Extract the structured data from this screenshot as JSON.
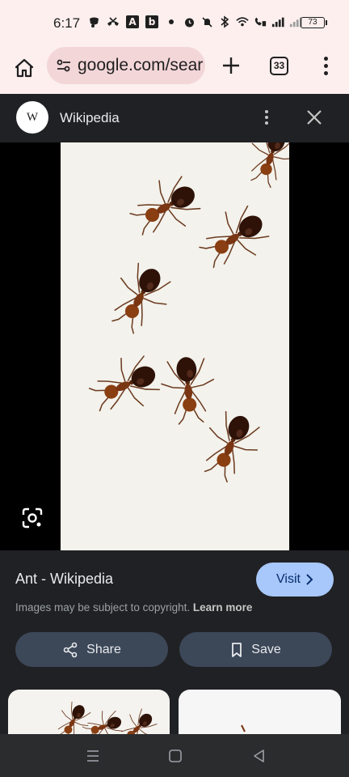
{
  "status_bar": {
    "time": "6:17",
    "left_icons": [
      "notification-icon",
      "missed-call-icon",
      "app-a-icon",
      "app-b-icon",
      "dot-icon"
    ],
    "right_icons": [
      "alarm-icon",
      "mute-icon",
      "bluetooth-icon",
      "wifi-icon",
      "wifi-calling-icon",
      "signal-icon",
      "signal-2-icon"
    ],
    "battery": "73"
  },
  "browser": {
    "url": "google.com/sear",
    "tab_count": "33",
    "icons": [
      "home-icon",
      "site-info-icon",
      "plus-icon",
      "more-vert-icon"
    ]
  },
  "panel": {
    "logo": "W",
    "title": "Wikipedia",
    "icons": [
      "more-vert-icon",
      "close-icon",
      "google-lens-icon"
    ]
  },
  "result": {
    "title": "Ant - Wikipedia",
    "visit_label": "Visit",
    "copyright": "Images may be subject to copyright.",
    "learn_more": "Learn more",
    "share_label": "Share",
    "save_label": "Save"
  },
  "colors": {
    "chrome_bg": "#fcefee",
    "omnibox_bg": "#f3d6d8",
    "panel_bg": "#202124",
    "visit_button": "#a8c7fa",
    "action_button": "#3c4758"
  }
}
